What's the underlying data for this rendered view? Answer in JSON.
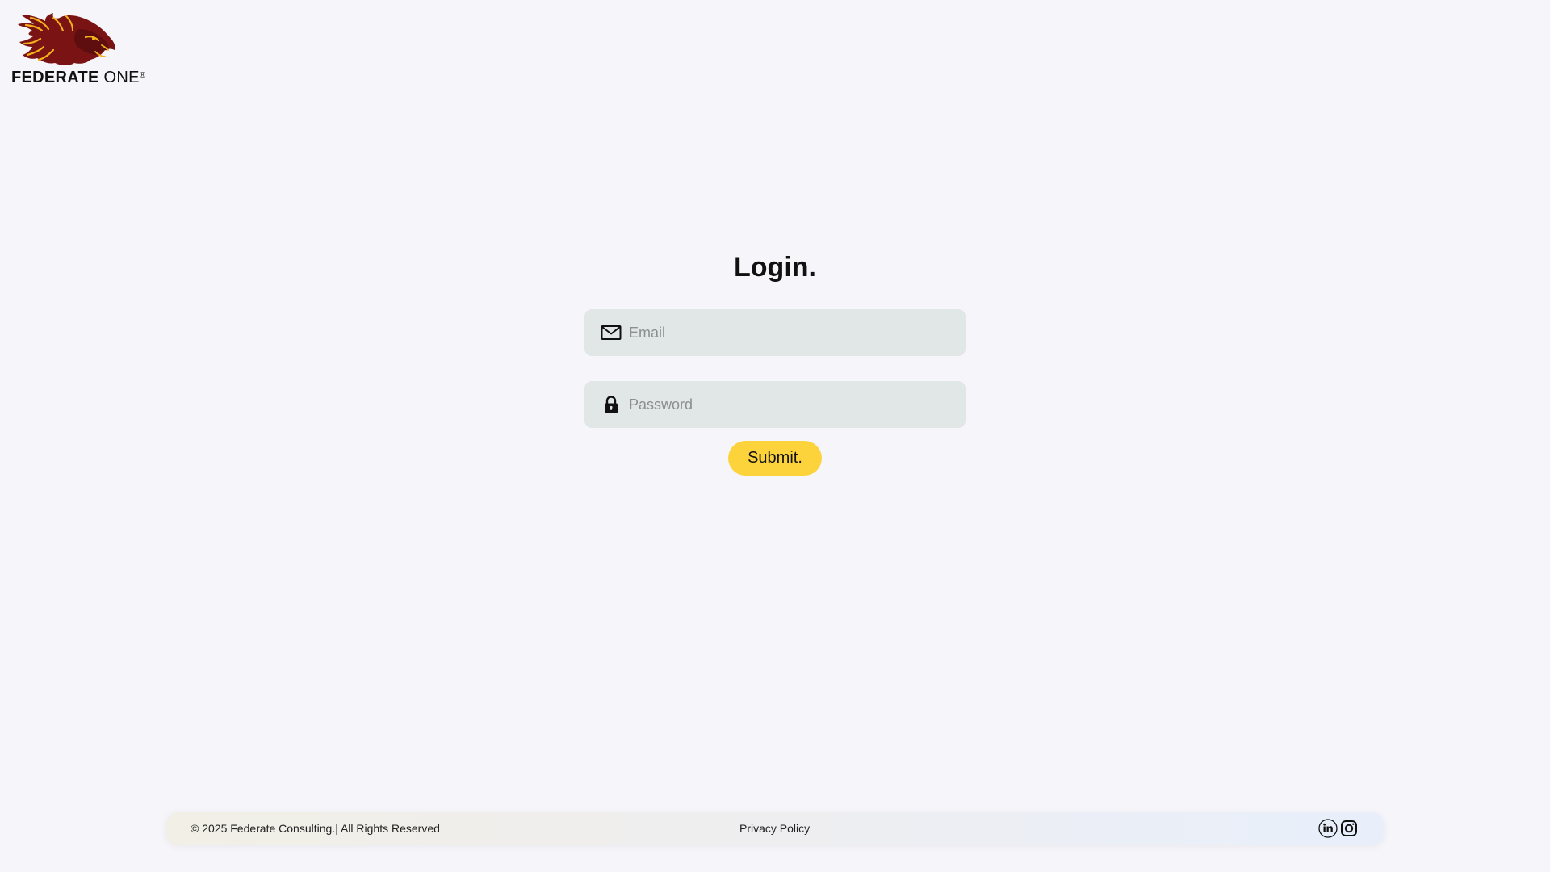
{
  "brand": {
    "name_bold": "FEDERATE",
    "name_light": " ONE",
    "registered_mark": "®",
    "colors": {
      "lion_primary": "#7a1414",
      "lion_accent": "#f5b21a"
    }
  },
  "login": {
    "title": "Login.",
    "email": {
      "placeholder": "Email",
      "value": "",
      "icon": "mail-icon"
    },
    "password": {
      "placeholder": "Password",
      "value": "",
      "icon": "lock-icon"
    },
    "submit_label": "Submit."
  },
  "footer": {
    "copyright": "© 2025 Federate Consulting.| All Rights Reserved",
    "privacy_label": "Privacy Policy",
    "social": [
      "linkedin-icon",
      "instagram-icon"
    ]
  },
  "colors": {
    "background": "#f5f5fa",
    "input_background": "#e1e6e6",
    "submit_button": "#fdd33c"
  }
}
